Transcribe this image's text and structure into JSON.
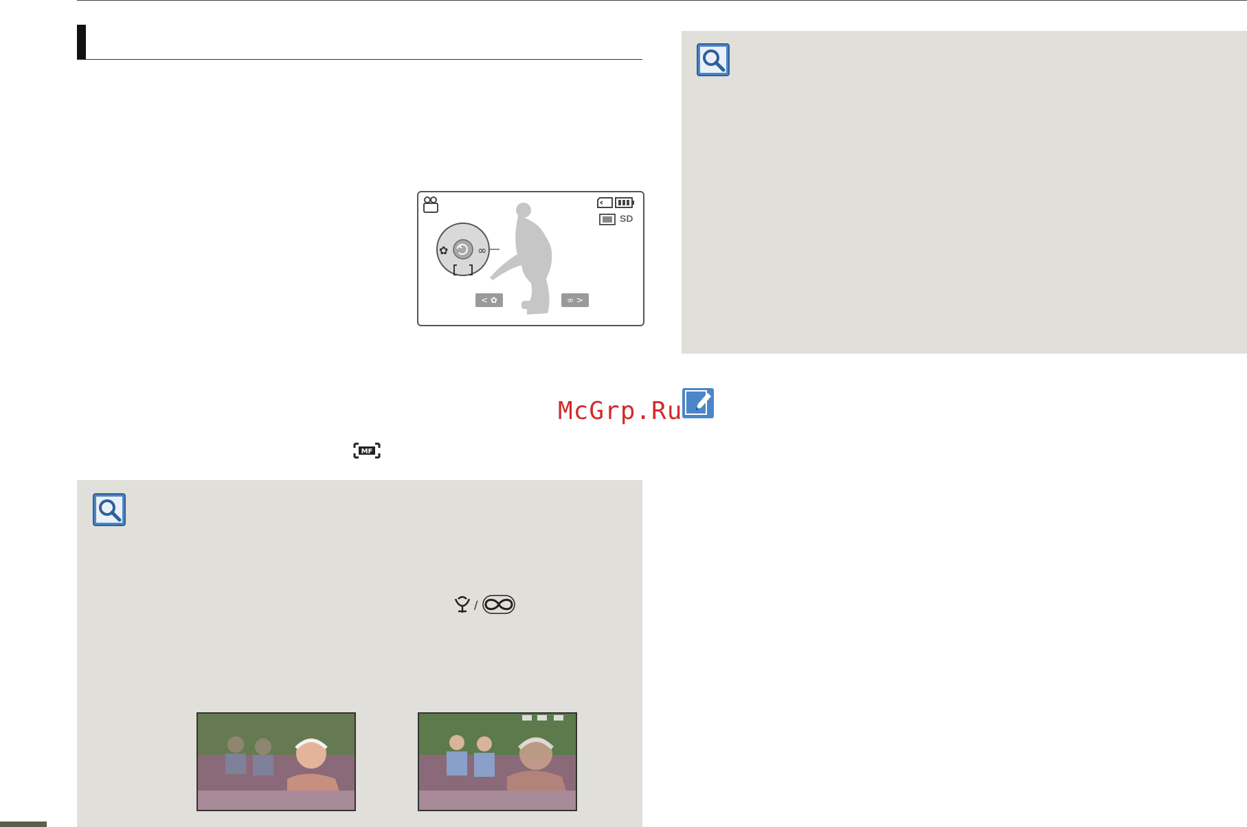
{
  "watermark": {
    "text": "McGrp.Ru"
  },
  "lcd": {
    "storage_label": "SD",
    "left_button_symbol": "< ✿",
    "right_button_symbol": "∞ >"
  },
  "icons": {
    "magnifier": "magnifier-icon",
    "note": "pencil-note-icon",
    "manual_focus": "mf-icon",
    "macro": "macro-flower-icon",
    "infinity": "infinity-icon",
    "camcorder": "camcorder-mode-icon",
    "battery": "battery-icon",
    "card": "memory-card-icon"
  },
  "colors": {
    "panel_background": "#e1dfd9",
    "icon_blue": "#4a86c8",
    "watermark_red": "#d42a2a",
    "lcd_button_gray": "#9a9a9a"
  }
}
